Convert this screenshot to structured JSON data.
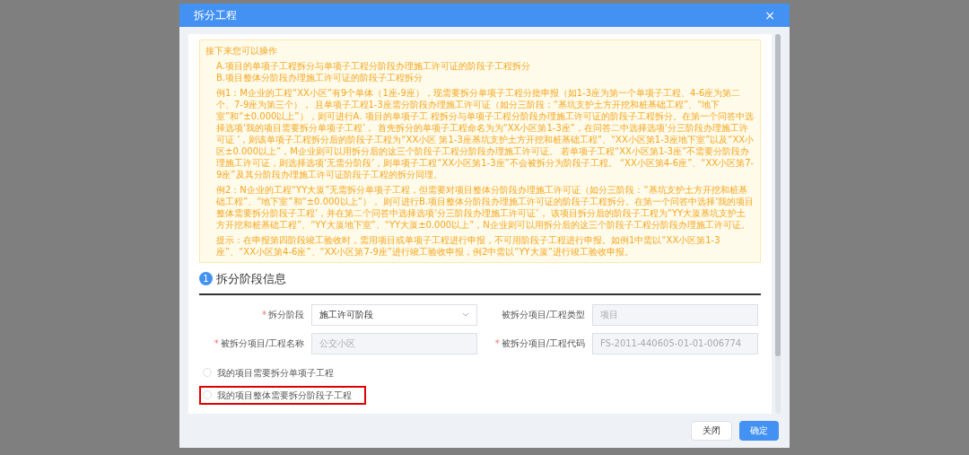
{
  "dialog": {
    "title": "拆分工程",
    "close": "×"
  },
  "notice": {
    "heading": "接下来您可以操作",
    "options": [
      "A.项目的单项子工程拆分与单项子工程分阶段办理施工许可证的阶段子工程拆分",
      "B.项目整体分阶段办理施工许可证的阶段子工程拆分"
    ],
    "paragraphs": [
      "例1：M企业的工程“XX小区”有9个单体（1座-9座），现需要拆分单项子工程分批申报（如1-3座为第一个单项子工程、4-6座为第二个、7-9座为第三个）， 且单项子工程1-3座需分阶段办理施工许可证（如分三阶段：“基坑支护土方开挖和桩基础工程”、“地下室”和“±0.000以上”），则可进行A. 项目的单项子工 程拆分与单项子工程分阶段办理施工许可证的阶段子工程拆分。在第一个问答中选择选项‘我的项目需要拆分单项子工程’， 首先拆分的单项子工程命名为为“XX小区第1-3座”，在问答二中选择选项‘分三阶段办理施工许可证 ’，则该单项子工程拆分后的阶段子工程为“XX小区 第1-3座基坑支护土方开挖和桩基础工程”、“XX小区第1-3座地下室”以及“XX小区±0.000以上”，M企业则可以用拆分后的这三个阶段子工程分阶段办理施工许可证。 若单项子工程“XX小区第1-3座”不需要分阶段办理施工许可证，则选择选项‘无需分阶段’，则单项子工程“XX小区第1-3座”不会被拆分为阶段子工程。 “XX小区第4-6座”、“XX小区第7-9座”及其分阶段办理施工许可证阶段子工程的拆分同理。",
      "例2：N企业的工程“YY大厦”无需拆分单项子工程，但需要对项目整体分阶段办理施工许可证（如分三阶段：“基坑支护土方开挖和桩基础工程”、“地下室”和“±0.000以上”）， 则可进行B.项目整体分阶段办理施工许可证的阶段子工程拆分。在第一个问答中选择‘我的项目整体需要拆分阶段子工程’，并在第二个问答中选择选项‘分三阶段办理施工许可证’， 该项目拆分后的阶段子工程为“YY大厦基坑支护土方开挖和桩基础工程”、“YY大厦地下室”、“YY大厦±0.000以上”，N企业则可以用拆分后的这三个阶段子工程分阶段办理施工许可证。",
      "提示：在申报第四阶段竣工验收时，需用项目或单项子工程进行申报，不可用阶段子工程进行申报。如例1中需以“XX小区第1-3座”、“XX小区第4-6座”、“XX小区第7-9座”进行竣工验收申报，例2中需以“YY大厦”进行竣工验收申报。"
    ]
  },
  "section": {
    "number": "1",
    "title": "拆分阶段信息"
  },
  "fields": [
    {
      "label": "拆分阶段",
      "required_mark": "*",
      "kind": "select",
      "value": "施工许可阶段"
    },
    {
      "label": "被拆分项目/工程类型",
      "kind": "text",
      "value": "项目",
      "disabled": true
    },
    {
      "label": "被拆分项目/工程名称",
      "required_mark": "*",
      "kind": "text",
      "value": "公交小区",
      "disabled": true
    },
    {
      "label": "被拆分项目/工程代码",
      "required_mark": "*",
      "kind": "text",
      "value": "FS-2011-440605-01-01-006774",
      "disabled": true
    }
  ],
  "checkboxes": [
    {
      "label": "我的项目需要拆分单项子工程",
      "checked": false,
      "highlighted": false
    },
    {
      "label": "我的项目整体需要拆分阶段子工程",
      "checked": false,
      "highlighted": true
    }
  ],
  "buttons": [
    {
      "label": "关闭",
      "kind": "secondary"
    },
    {
      "label": "确定",
      "kind": "primary"
    }
  ]
}
